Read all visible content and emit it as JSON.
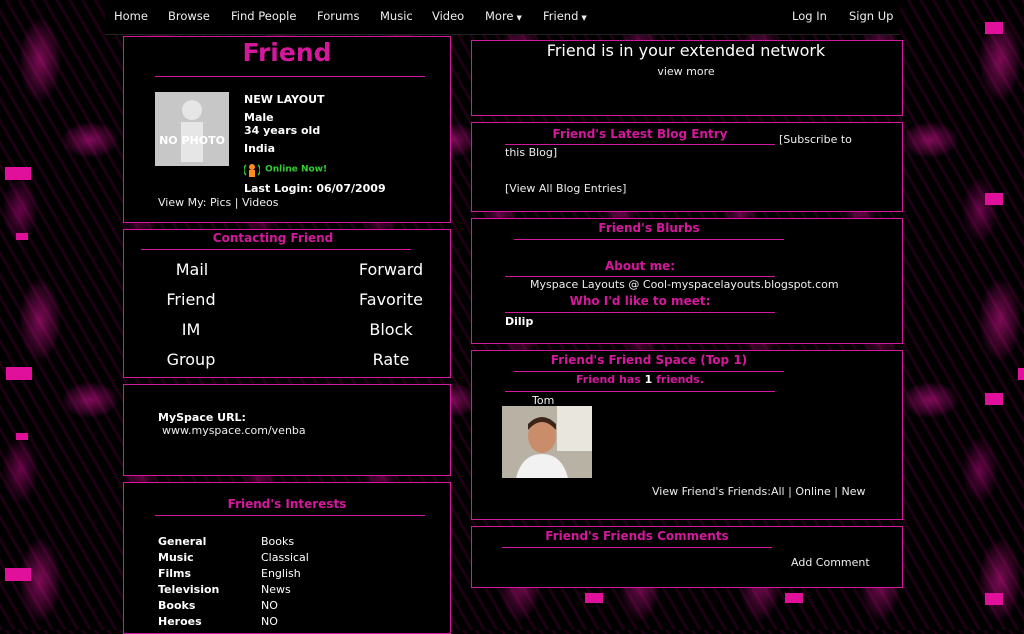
{
  "nav": {
    "items": [
      "Home",
      "Browse",
      "Find People",
      "Forums",
      "Music",
      "Video",
      "More",
      "Friend"
    ],
    "login": "Log In",
    "signup": "Sign Up"
  },
  "profile": {
    "name": "Friend",
    "photo_label": "NO PHOTO",
    "headline": "NEW LAYOUT",
    "gender": "Male",
    "age": "34 years old",
    "country": "India",
    "online": "Online Now!",
    "last_login": "Last Login: 06/07/2009",
    "view_my_label": "View My:",
    "pics": "Pics",
    "separator": "|",
    "videos": "Videos"
  },
  "contacting": {
    "title": "Contacting Friend",
    "buttons": [
      "Mail",
      "Forward",
      "Friend",
      "Favorite",
      "IM",
      "Block",
      "Group",
      "Rate"
    ]
  },
  "url_box": {
    "label": "MySpace URL:",
    "value": "www.myspace.com/venba"
  },
  "interests": {
    "title": "Friend's Interests",
    "rows": [
      {
        "key": "General",
        "value": "Books"
      },
      {
        "key": "Music",
        "value": "Classical"
      },
      {
        "key": "Films",
        "value": "English"
      },
      {
        "key": "Television",
        "value": "News"
      },
      {
        "key": "Books",
        "value": "NO"
      },
      {
        "key": "Heroes",
        "value": "NO"
      }
    ]
  },
  "network": {
    "text": "Friend is in your extended network",
    "view_more": "view more"
  },
  "blog": {
    "title": "Friend's Latest Blog Entry",
    "subscribe_a": "[Subscribe to",
    "subscribe_b": "this Blog]",
    "view_all": "[View All Blog Entries]"
  },
  "blurbs": {
    "title": "Friend's Blurbs",
    "about_label": "About me:",
    "about_text": "Myspace Layouts @ Cool-myspacelayouts.blogspot.com",
    "meet_label": "Who I'd like to meet:",
    "meet_text": "Dilip"
  },
  "friend_space": {
    "title": "Friend's Friend Space (Top 1)",
    "count_pre": "Friend has",
    "count": "1",
    "count_post": "friends.",
    "friend_name": "Tom",
    "view_label": "View Friend's Friends:",
    "all": "All",
    "online": "Online",
    "new": "New",
    "sep": "|"
  },
  "comments": {
    "title": "Friend's Friends Comments",
    "add": "Add Comment"
  },
  "colors": {
    "accent": "#d4189c",
    "online": "#33cc33",
    "background": "#000000"
  }
}
